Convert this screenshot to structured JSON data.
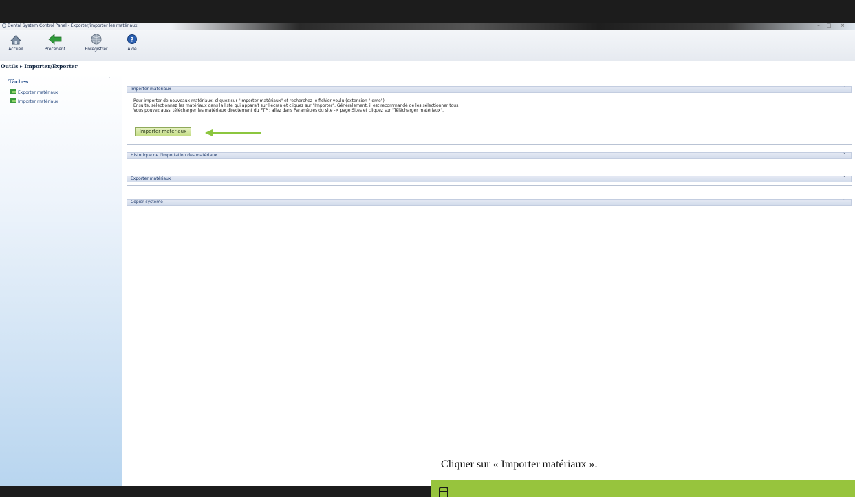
{
  "window": {
    "title": "Dental System Control Panel - Exporter/importer les matériaux",
    "minimize": "–",
    "maximize": "□",
    "close": "×"
  },
  "toolbar": {
    "items": [
      {
        "label": "Accueil",
        "icon": "home-icon"
      },
      {
        "label": "Précédent",
        "icon": "back-arrow-icon"
      },
      {
        "label": "Enregistrer",
        "icon": "save-globe-icon"
      },
      {
        "label": "Aide",
        "icon": "help-icon"
      }
    ]
  },
  "breadcrumb": {
    "root": "Outils",
    "separator": "▸",
    "current": "Importer/Exporter"
  },
  "sidebar": {
    "header": "Tâches",
    "collapse_glyph": "ˆ",
    "items": [
      {
        "label": "Exporter matériaux",
        "icon": "export-icon"
      },
      {
        "label": "Importer matériaux",
        "icon": "import-icon"
      }
    ]
  },
  "panels": [
    {
      "title": "Importer matériaux",
      "chevron": "ˆ",
      "expanded": true,
      "lines": [
        "Pour importer de nouveaux matériaux, cliquez sur \"Importer matériaux\" et recherchez le fichier voulu (extension \".dme\").",
        "Ensuite, sélectionnez les matériaux dans la liste qui apparaît sur l'écran et cliquez sur \"Importer\". Généralement, il est recommandé de les sélectionner tous.",
        "Vous pouvez aussi télécharger les matériaux directement du FTP : allez dans Paramètres du site -> page Sites et cliquez sur \"Télécharger matériaux\"."
      ],
      "button_label": "Importer matériaux"
    },
    {
      "title": "Historique de l'importation des matériaux",
      "chevron": "ˇ",
      "expanded": false
    },
    {
      "title": "Exporter matériaux",
      "chevron": "ˇ",
      "expanded": false
    },
    {
      "title": "Copier système",
      "chevron": "ˇ",
      "expanded": false
    }
  ],
  "caption": "Cliquer sur « Importer matériaux ».",
  "colors": {
    "accent_green": "#97c43d",
    "arrow_green": "#8cc63f",
    "panel_header": "#d3dcec",
    "sidebar_blue": "#b8d5ef"
  }
}
